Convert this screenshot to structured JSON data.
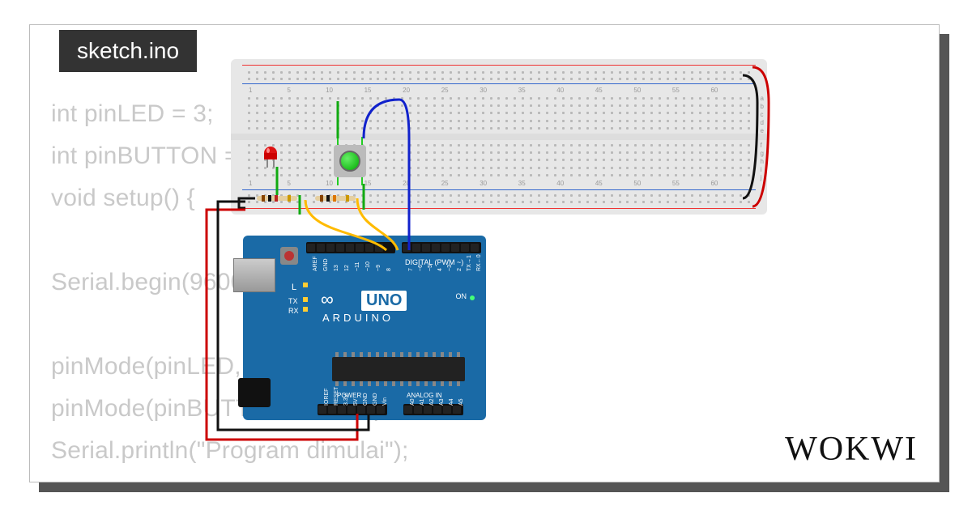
{
  "tab_title": "sketch.ino",
  "brand": "WOKWI",
  "code_lines": [
    "int pinLED = 3;",
    "int pinBUTTON = 2;",
    "void setup() {",
    "",
    "Serial.begin(9600);",
    "",
    "pinMode(pinLED, OUTPUT);",
    "pinMode(pinBUTTON, INPUT);",
    "Serial.println(\"Program dimulai\");"
  ],
  "breadboard": {
    "col_numbers": [
      "1",
      "5",
      "10",
      "15",
      "20",
      "25",
      "30",
      "35",
      "40",
      "45",
      "50",
      "55",
      "60"
    ],
    "row_labels_top": [
      "a",
      "b",
      "c",
      "d",
      "e"
    ],
    "row_labels_bot": [
      "f",
      "g",
      "h",
      "i",
      "j"
    ]
  },
  "components": {
    "led": {
      "color": "red",
      "name": "red-led"
    },
    "button": {
      "color": "green",
      "name": "push-button"
    },
    "resistors": [
      "resistor-1",
      "resistor-2"
    ]
  },
  "wires": [
    {
      "name": "wire-5v-red",
      "color": "#c00"
    },
    {
      "name": "wire-gnd-black",
      "color": "#111"
    },
    {
      "name": "wire-led-green",
      "color": "#1a1"
    },
    {
      "name": "wire-button-blue",
      "color": "#12c"
    },
    {
      "name": "wire-pin3-yellow",
      "color": "#fb0"
    },
    {
      "name": "wire-pin2-yellow",
      "color": "#fb0"
    },
    {
      "name": "wire-button-gnd-green",
      "color": "#1a1"
    },
    {
      "name": "wire-rail-top-red",
      "color": "#c00"
    },
    {
      "name": "wire-rail-top-black",
      "color": "#111"
    },
    {
      "name": "wire-rail-bot-red",
      "color": "#c00"
    },
    {
      "name": "wire-rail-bot-black",
      "color": "#111"
    }
  ],
  "arduino": {
    "board": "UNO",
    "brand": "ARDUINO",
    "sections": {
      "digital": "DIGITAL (PWM ~)",
      "power": "POWER",
      "analog": "ANALOG IN"
    },
    "leds": {
      "tx": "TX",
      "rx": "RX",
      "l": "L",
      "on": "ON"
    },
    "digital_pins": [
      "AREF",
      "GND",
      "13",
      "12",
      "~11",
      "~10",
      "~9",
      "8",
      "7",
      "~6",
      "~5",
      "4",
      "~3",
      "2",
      "TX→1",
      "RX←0"
    ],
    "power_pins": [
      "IOREF",
      "RESET",
      "3.3V",
      "5V",
      "GND",
      "GND",
      "Vin"
    ],
    "analog_pins": [
      "A0",
      "A1",
      "A2",
      "A3",
      "A4",
      "A5"
    ]
  }
}
